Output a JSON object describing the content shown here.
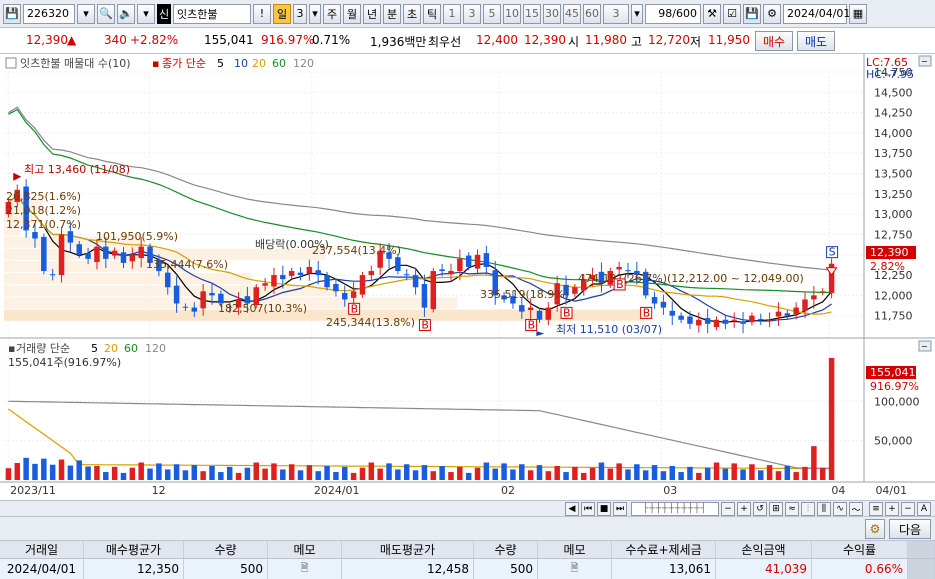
{
  "toolbar": {
    "code": "226320",
    "stock_name": "잇츠한불",
    "period_active": "일",
    "period_num": "3",
    "periods": [
      "주",
      "월",
      "년",
      "분",
      "초",
      "틱"
    ],
    "minute_nums": [
      "1",
      "3",
      "5",
      "10",
      "15",
      "30",
      "45",
      "60"
    ],
    "unit_select": "3",
    "count": "98/600",
    "date": "2024/04/01",
    "shin_label": "신",
    "excl_label": "!"
  },
  "quote": {
    "price": "12,390",
    "change": "340",
    "rate": "+2.82%",
    "volume": "155,041",
    "volume_ratio": "916.97%",
    "turnover": "0.71%",
    "amount": "1,936백만",
    "best_ask_label": "최우선",
    "best_ask": "12,400",
    "best_bid": "12,390",
    "open_label": "시",
    "open": "11,980",
    "high_label": "고",
    "high": "12,720",
    "low_label": "저",
    "low": "11,950",
    "buy_label": "매수",
    "sell_label": "매도"
  },
  "price_panel": {
    "legend_title": "잇츠한불 매물대 수(10)",
    "legend_ma": "종가 단순",
    "ma_periods": [
      "5",
      "10",
      "20",
      "60",
      "120"
    ],
    "lc": "LC:7.65",
    "hc": "HC:-7.95",
    "current_price_label": "12,390",
    "current_rate_label": "2.82%",
    "annotations": {
      "high": "최고 13,460 (11/08)",
      "low": "최저 11,510 (03/07)",
      "dividend": "배당락(0.00%)"
    },
    "volume_profile_labels": [
      "26,825(1.6%)",
      "21,018(1.2%)",
      "12,371(0.7%)",
      "101,950(5.9%)",
      "237,554(13.4%)",
      "135,444(7.6%)",
      "182,507(10.3%)",
      "245,344(13.8%)",
      "335,519(18.9%)",
      "474,191(26.7%)(12,212.00 ~ 12,049.00)"
    ]
  },
  "volume_panel": {
    "legend_title": "거래량 단순",
    "ma_periods": [
      "5",
      "20",
      "60",
      "120"
    ],
    "value_label": "155,041주(916.97%)",
    "current_label": "155,041",
    "current_rate": "916.97%"
  },
  "chart_data": [
    {
      "type": "candlestick",
      "ylim": [
        11500,
        14750
      ],
      "yticks": [
        11750,
        12000,
        12250,
        12500,
        12750,
        13000,
        13250,
        13500,
        13750,
        14000,
        14250,
        14500,
        14750
      ],
      "ytick_labels": [
        "11,750",
        "12,000",
        "12,250",
        "12,500",
        "12,750",
        "13,000",
        "13,250",
        "13,500",
        "13,750",
        "14,000",
        "14,250",
        "14,500",
        "14,750"
      ],
      "xtick_labels": [
        "2023/11",
        "12",
        "2024/01",
        "02",
        "03",
        "04",
        "04/01"
      ],
      "close": [
        13150,
        13300,
        12800,
        12700,
        12300,
        12250,
        12750,
        12650,
        12500,
        12450,
        12600,
        12450,
        12550,
        12400,
        12500,
        12600,
        12400,
        12300,
        12100,
        11900,
        11850,
        11800,
        12050,
        12000,
        11900,
        11850,
        11950,
        11900,
        12100,
        12150,
        12250,
        12200,
        12300,
        12250,
        12350,
        12250,
        12100,
        12050,
        11950,
        12050,
        12250,
        12300,
        12550,
        12450,
        12300,
        12250,
        12100,
        11850,
        12300,
        12300,
        12300,
        12450,
        12350,
        12500,
        12350,
        12000,
        11950,
        11900,
        11800,
        11850,
        11700,
        11850,
        12150,
        12000,
        12100,
        12200,
        12250,
        12150,
        12300,
        12350,
        12300,
        12250,
        12000,
        11900,
        11850,
        11750,
        11700,
        11650,
        11700,
        11650,
        11700,
        11650,
        11700,
        11650,
        11750,
        11700,
        11700,
        11800,
        11750,
        11850,
        11950,
        12000,
        12050,
        12390
      ],
      "volume_ylim": [
        0,
        160000
      ],
      "volume_ticks": [
        50000,
        100000
      ],
      "volume_tick_labels": [
        "50,000",
        "100,000"
      ],
      "volume_last": 155041
    }
  ],
  "table": {
    "next_label": "다음",
    "headers": [
      "거래일",
      "매수평균가",
      "수량",
      "메모",
      "매도평균가",
      "수량",
      "메모",
      "수수료+제세금",
      "손익금액",
      "수익률"
    ],
    "row": [
      "2024/04/01",
      "12,350",
      "500",
      "",
      "12,458",
      "500",
      "",
      "13,061",
      "41,039",
      "0.66%"
    ]
  }
}
